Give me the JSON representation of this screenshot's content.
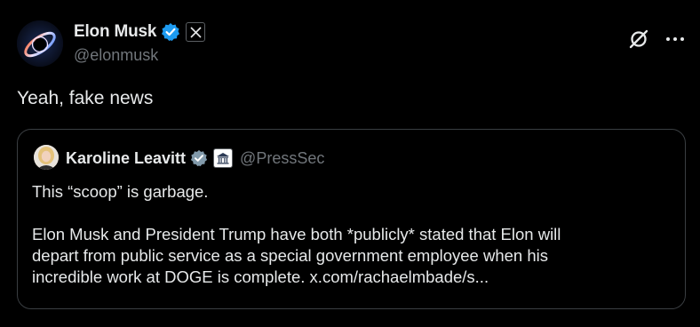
{
  "post": {
    "author": {
      "display_name": "Elon Musk",
      "handle": "@elonmusk",
      "verified": true,
      "affiliation_badge": "x-logo"
    },
    "text": "Yeah, fake news",
    "actions": [
      "grok-icon",
      "more-icon"
    ]
  },
  "quote": {
    "author": {
      "display_name": "Karoline Leavitt",
      "handle": "@PressSec",
      "verified": true,
      "affiliation_badge": "white-house-icon"
    },
    "line1": "This “scoop” is garbage.",
    "line2_a": "Elon Musk and President Trump have both *publicly* stated that Elon will",
    "line2_b": "depart from public service as a special government employee when his",
    "line2_c": "incredible work at DOGE is complete. x.com/rachaelmbade/s..."
  },
  "colors": {
    "background": "#000000",
    "primary_text": "#e7e9ea",
    "secondary_text": "#71767b",
    "verified_blue": "#1d9bf0",
    "verified_gray": "#829aab",
    "border": "#3a3e42"
  }
}
